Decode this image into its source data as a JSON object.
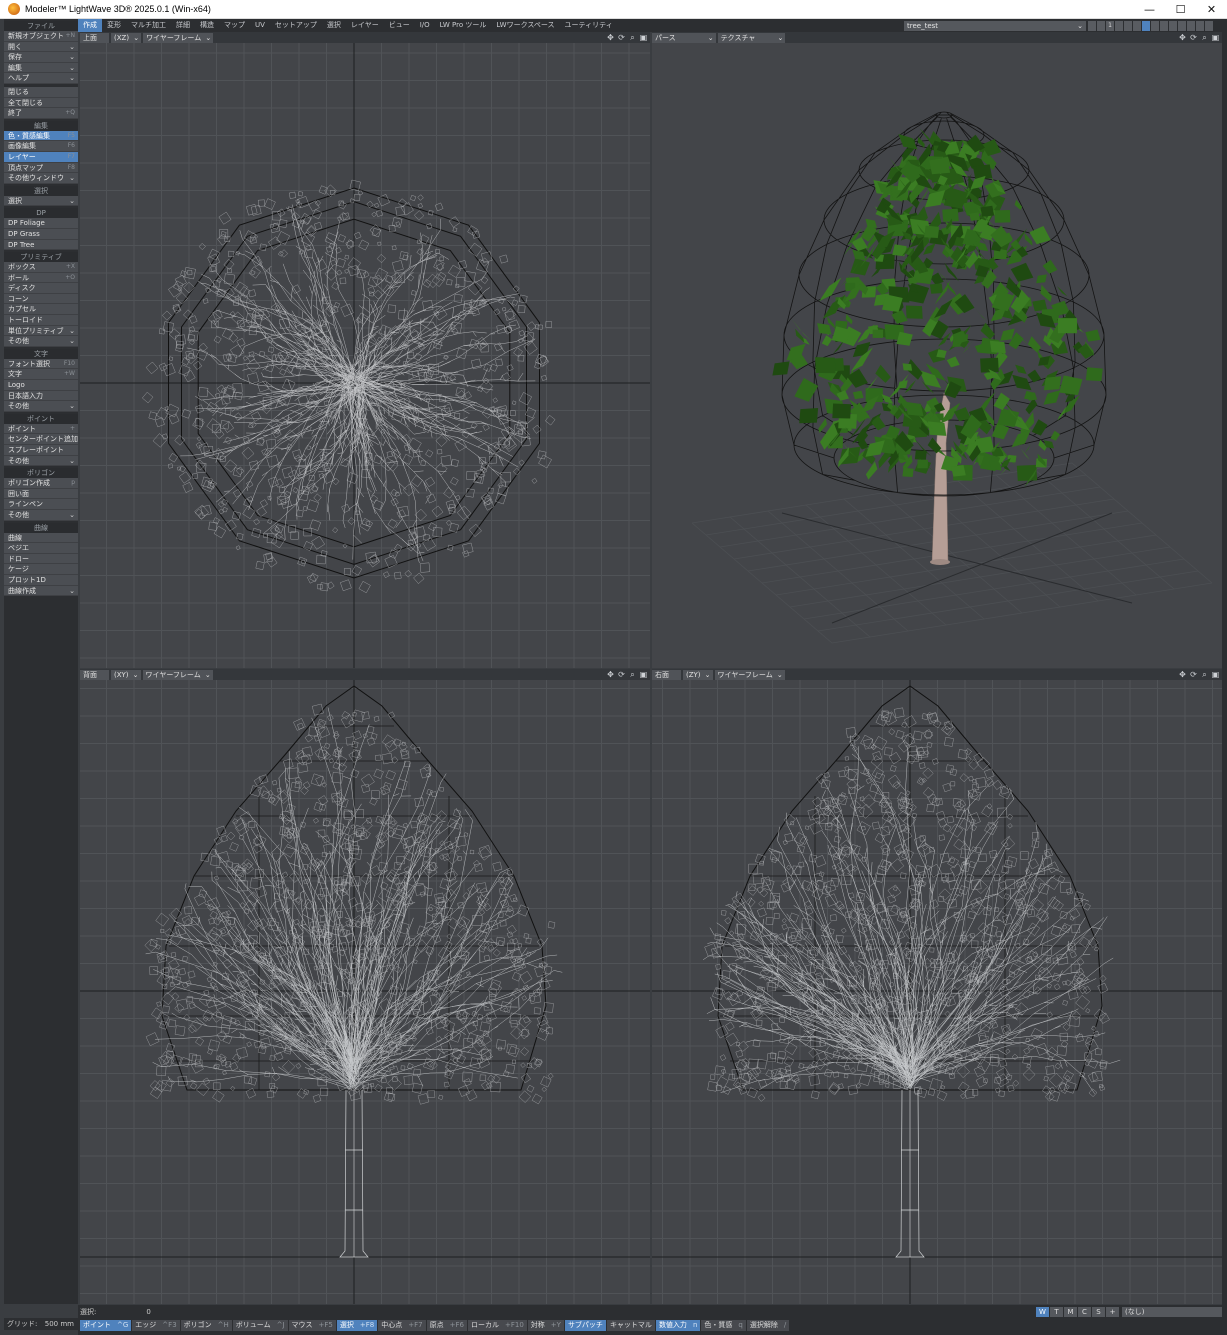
{
  "window": {
    "title": "Modeler™ LightWave 3D® 2025.0.1 (Win-x64)",
    "buttons": [
      "—",
      "☐",
      "✕"
    ]
  },
  "tabs": [
    "作成",
    "変形",
    "マルチ加工",
    "詳細",
    "構造",
    "マップ",
    "UV",
    "セットアップ",
    "選択",
    "レイヤー",
    "ビュー",
    "I/O",
    "LW Pro ツール",
    "LWワークスペース",
    "ユーティリティ"
  ],
  "active_tab": "作成",
  "object_selector": "tree_test",
  "layer_label": "1",
  "sidebar": {
    "file_head": "ファイル",
    "file": [
      {
        "label": "新規オブジェクト",
        "shortcut": "+N"
      },
      {
        "label": "開く",
        "dd": true
      },
      {
        "label": "保存",
        "dd": true
      },
      {
        "label": "編集",
        "dd": true
      },
      {
        "label": "ヘルプ",
        "dd": true
      }
    ],
    "file2": [
      {
        "label": "閉じる"
      },
      {
        "label": "全て閉じる"
      },
      {
        "label": "終了",
        "shortcut": "+Q"
      }
    ],
    "edit_head": "編集",
    "edit": [
      {
        "label": "色・質感編集",
        "shortcut": "F5",
        "selected": true
      },
      {
        "label": "画像編集",
        "shortcut": "F6"
      },
      {
        "label": "レイヤー",
        "shortcut": "F7",
        "selected": true
      },
      {
        "label": "頂点マップ",
        "shortcut": "F8"
      },
      {
        "label": "その他ウィンドウ",
        "dd": true
      }
    ],
    "select_head": "選択",
    "select": [
      {
        "label": "選択",
        "dd": true
      }
    ],
    "dp_head": "DP",
    "dp": [
      {
        "label": "DP Foliage"
      },
      {
        "label": "DP Grass"
      },
      {
        "label": "DP Tree"
      }
    ],
    "primitive_head": "プリミティブ",
    "primitive": [
      {
        "label": "ボックス",
        "shortcut": "+X"
      },
      {
        "label": "ボール",
        "shortcut": "+O"
      },
      {
        "label": "ディスク"
      },
      {
        "label": "コーン"
      },
      {
        "label": "カプセル"
      },
      {
        "label": "トーロイド"
      },
      {
        "label": "単位プリミティブ",
        "dd": true
      },
      {
        "label": "その他",
        "dd": true
      }
    ],
    "text_head": "文字",
    "text": [
      {
        "label": "フォント選択",
        "shortcut": "F10"
      },
      {
        "label": "文字",
        "shortcut": "+W"
      },
      {
        "label": "Logo"
      },
      {
        "label": "日本語入力"
      },
      {
        "label": "その他",
        "dd": true
      }
    ],
    "point_head": "ポイント",
    "point": [
      {
        "label": "ポイント",
        "shortcut": "+"
      },
      {
        "label": "センターポイント追加"
      },
      {
        "label": "スプレーポイント"
      },
      {
        "label": "その他",
        "dd": true
      }
    ],
    "polygon_head": "ポリゴン",
    "polygon": [
      {
        "label": "ポリゴン作成",
        "shortcut": "p"
      },
      {
        "label": "囲い面"
      },
      {
        "label": "ラインペン"
      },
      {
        "label": "その他",
        "dd": true
      }
    ],
    "curve_head": "曲線",
    "curve": [
      {
        "label": "曲線"
      },
      {
        "label": "ベジエ"
      },
      {
        "label": "ドロー"
      },
      {
        "label": "ケージ"
      },
      {
        "label": "プロット1D"
      },
      {
        "label": "曲線作成",
        "dd": true
      }
    ]
  },
  "viewports": {
    "top": {
      "view": "上面",
      "axis": "(XZ)",
      "mode": "ワイヤーフレーム"
    },
    "persp": {
      "view": "パース",
      "mode": "テクスチャ"
    },
    "front": {
      "view": "背面",
      "axis": "(XY)",
      "mode": "ワイヤーフレーム"
    },
    "right": {
      "view": "右面",
      "axis": "(ZY)",
      "mode": "ワイヤーフレーム"
    }
  },
  "status": {
    "grid_label": "グリッド:",
    "grid_value": "500 mm",
    "select_label": "選択:",
    "select_count": "0",
    "wtmcs": [
      "W",
      "T",
      "M",
      "C",
      "S",
      "+"
    ],
    "surface": "(なし)",
    "modes": [
      {
        "label": "ポイント",
        "key": "^G",
        "on": true
      },
      {
        "label": "エッジ",
        "key": "^F3"
      },
      {
        "label": "ポリゴン",
        "key": "^H"
      },
      {
        "label": "ボリューム",
        "key": "^J"
      },
      {
        "label": "マウス",
        "key": "+F5"
      },
      {
        "label": "選択",
        "key": "+F8",
        "on": true
      },
      {
        "label": "中心点",
        "key": "+F7"
      },
      {
        "label": "原点",
        "key": "+F6"
      },
      {
        "label": "ローカル",
        "key": "+F10"
      },
      {
        "label": "対称",
        "key": "+Y"
      },
      {
        "label": "サブパッチ",
        "key": "",
        "on": true
      },
      {
        "label": "キャットマル",
        "key": ""
      },
      {
        "label": "数値入力",
        "key": "n",
        "on": true
      },
      {
        "label": "色・質感",
        "key": "q"
      },
      {
        "label": "選択解除",
        "key": "/"
      }
    ]
  },
  "colors": {
    "accent": "#4f82bd",
    "viewport_bg": "#434549",
    "foliage": "#2f6a1c",
    "trunk": "#b59e96"
  }
}
